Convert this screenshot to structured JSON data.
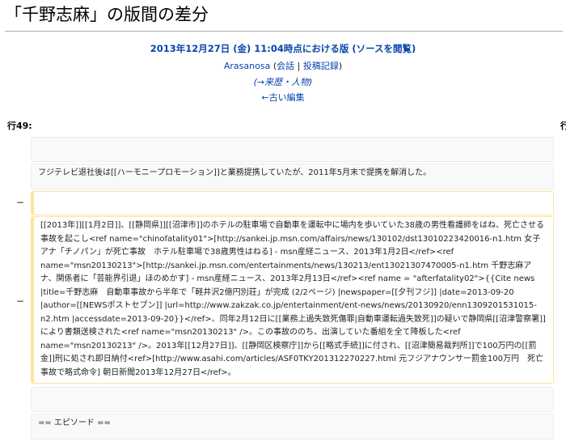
{
  "page": {
    "title": "「千野志麻」の版間の差分"
  },
  "revision": {
    "title": "2013年12月27日 (金) 11:04時点における版 (ソースを閲覧)",
    "user": "Arasanosa",
    "talk": "会話",
    "separator": "|",
    "contribs": "投稿記録",
    "open_paren": "(",
    "close_paren": ")",
    "summary": "(→来歴・人物)",
    "prev_edit": "←古い編集"
  },
  "diff": {
    "line_label": "行49:",
    "line_label_right": "行",
    "marker_minus": "−",
    "rows": [
      {
        "type": "context",
        "text": ""
      },
      {
        "type": "context",
        "text": "フジテレビ退社後は[[ハーモニープロモーション]]と業務提携していたが、2011年5月末で提携を解消した。"
      },
      {
        "type": "deleted",
        "text": ""
      },
      {
        "type": "deleted",
        "text": "[[2013年]][[1月2日]]、[[静岡県]][[沼津市]]のホテルの駐車場で自動車を運転中に場内を歩いていた38歳の男性看護師をはね、死亡させる事故を起こし<ref name=\"chinofatality01\">[http://sankei.jp.msn.com/affairs/news/130102/dst13010223420016-n1.htm 女子アナ「チノパン」が死亡事故　ホテル駐車場で38歳男性はねる] - msn産経ニュース、2013年1月2日</ref><ref name=\"msn20130213\">[http://sankei.jp.msn.com/entertainments/news/130213/ent13021307470005-n1.htm 千野志麻アナ、関係者に「芸能界引退」ほのめかす] - msn産経ニュース、2013年2月13日</ref><ref name = \"afterfatality02\">{{Cite news |title=千野志麻　自動車事故から半年で「軽井沢2億円別荘」が完成 (2/2ページ) |newspaper=[[夕刊フジ]] |date=2013-09-20 |author=[[NEWSポストセブン]] |url=http://www.zakzak.co.jp/entertainment/ent-news/news/20130920/enn1309201531015-n2.htm |accessdate=2013-09-20}}</ref>、同年2月12日に[[業務上過失致死傷罪|自動車運転過失致死]]の疑いで静岡県[[沼津警察署]]により書類送検された<ref name=\"msn20130213\" />。この事故ののち、出演していた番組を全て降板した<ref name=\"msn20130213\" />。2013年[[12月27日]]、[[静岡区検察庁]]から[[略式手続]]に付され、[[沼津簡易裁判所]]で100万円の[[罰金]]刑に処され即日納付<ref>[http://www.asahi.com/articles/ASF0TKY201312270227.html 元フジアナウンサー罰金100万円　死亡事故で略式命令] 朝日新聞2013年12月27日</ref>。"
      },
      {
        "type": "context",
        "text": ""
      },
      {
        "type": "context",
        "text": "== エピソード =="
      }
    ]
  }
}
